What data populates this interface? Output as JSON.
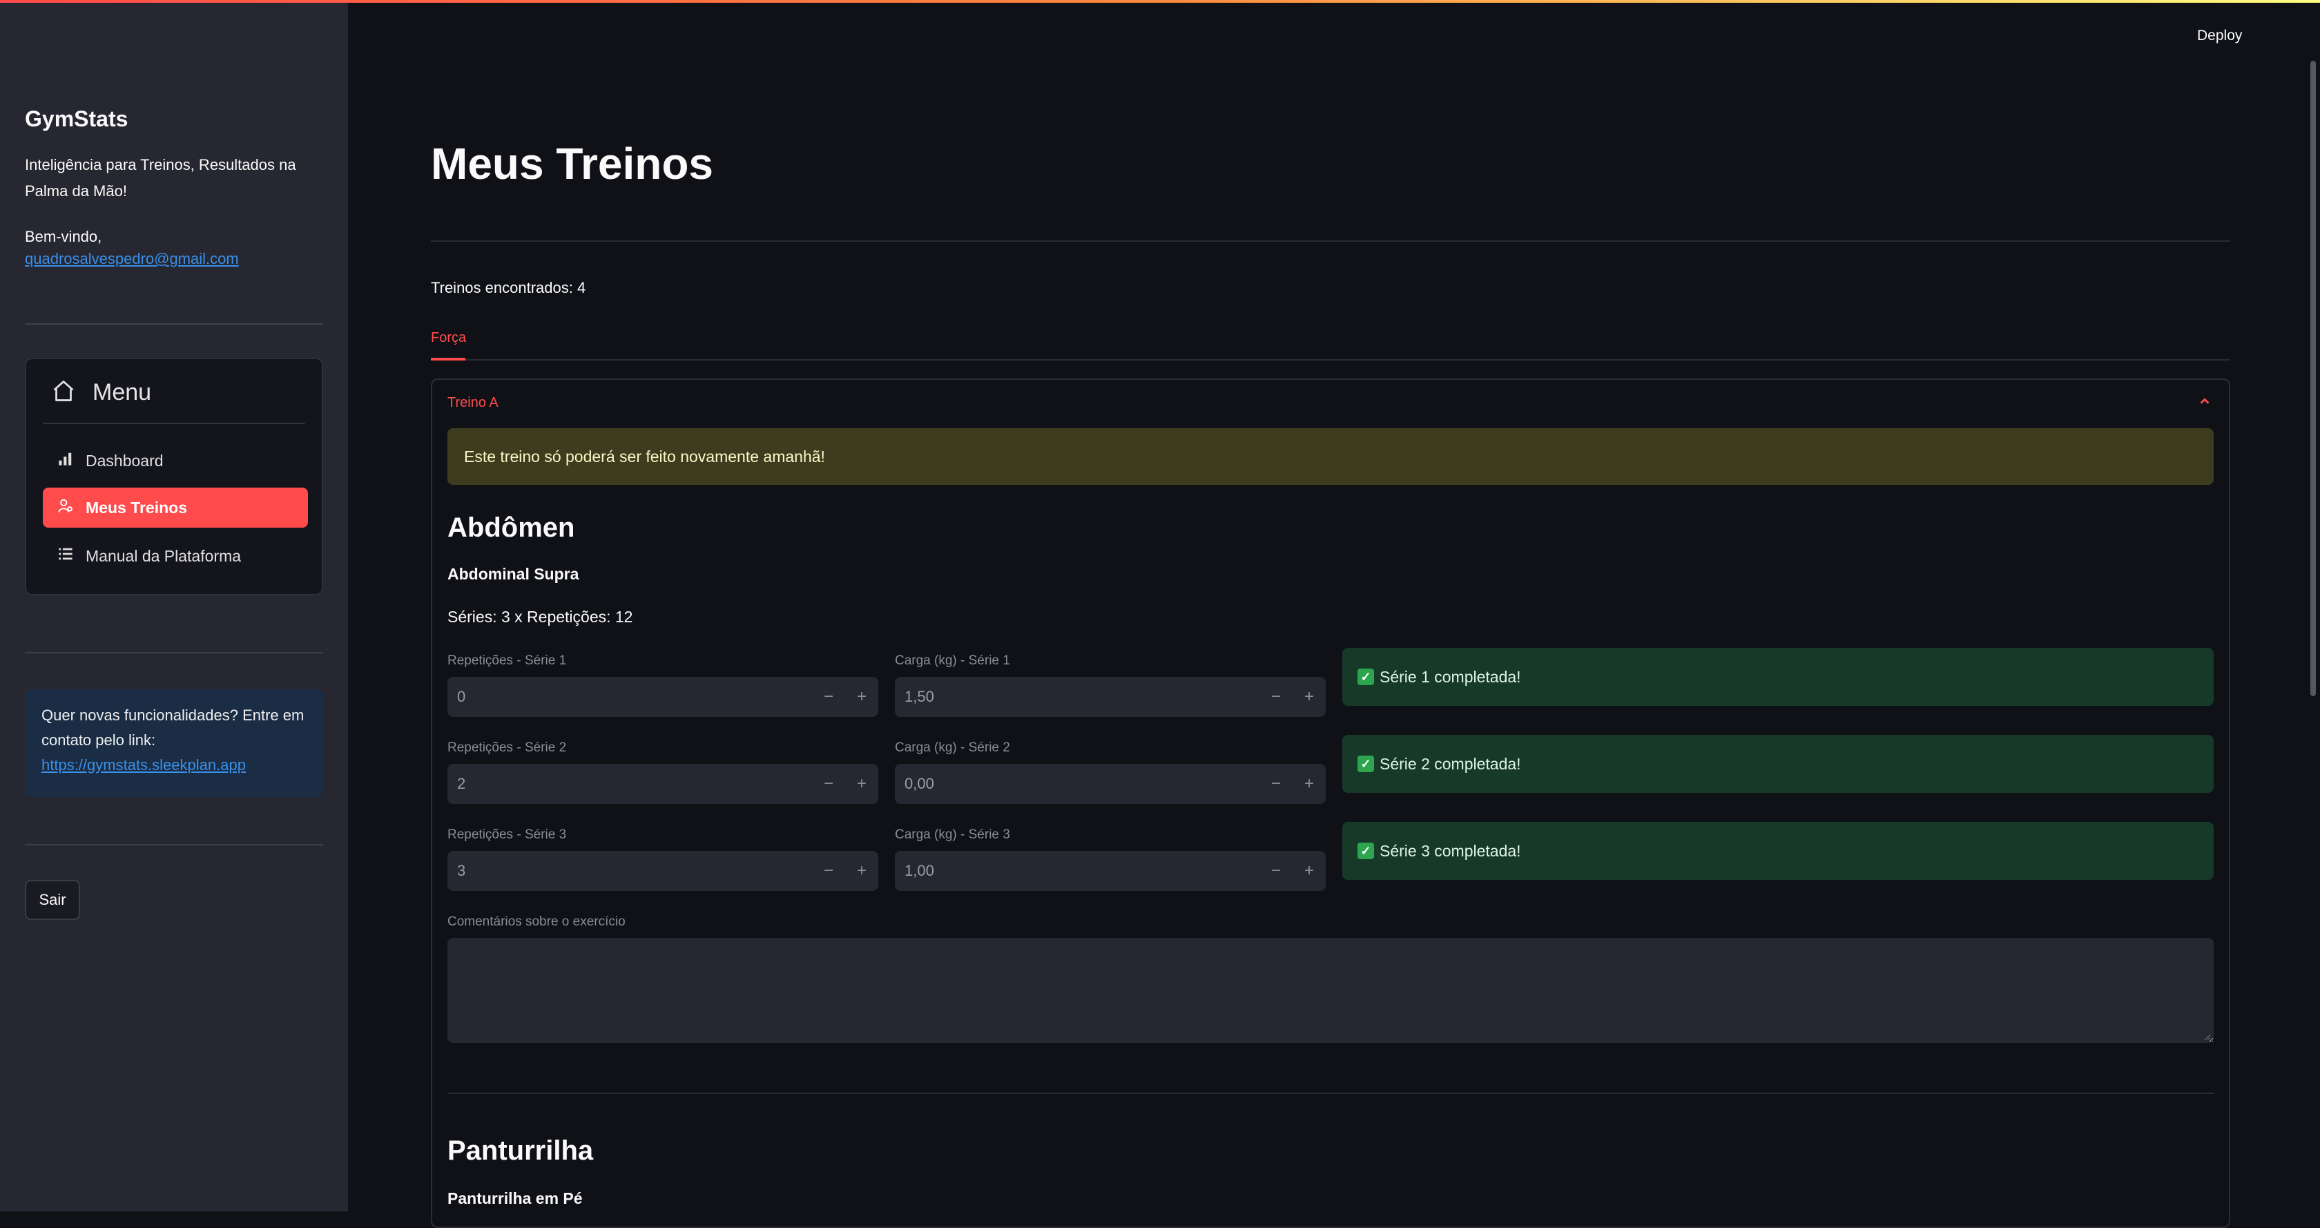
{
  "sidebar": {
    "app_title": "GymStats",
    "tagline": "Inteligência para Treinos, Resultados na Palma da Mão!",
    "welcome": "Bem-vindo,",
    "email": "quadrosalvespedro@gmail.com",
    "menu": {
      "title": "Menu",
      "items": [
        {
          "label": "Dashboard",
          "icon": "bar-chart-icon"
        },
        {
          "label": "Meus Treinos",
          "icon": "person-icon",
          "active": true
        },
        {
          "label": "Manual da Plataforma",
          "icon": "list-icon"
        }
      ]
    },
    "info": {
      "text": "Quer novas funcionalidades? Entre em contato pelo link:",
      "link": "https://gymstats.sleekplan.app"
    },
    "logout_label": "Sair"
  },
  "header": {
    "deploy_label": "Deploy"
  },
  "main": {
    "title": "Meus Treinos",
    "found_text": "Treinos encontrados: 4",
    "tabs": [
      {
        "label": "Força",
        "active": true
      }
    ],
    "expander": {
      "title": "Treino A",
      "warning": "Este treino só poderá ser feito novamente amanhã!",
      "sections": [
        {
          "heading": "Abdômen",
          "exercise": "Abdominal Supra",
          "series_text": "Séries: 3 x Repetições: 12",
          "rows": [
            {
              "reps_label": "Repetições - Série 1",
              "reps_value": "0",
              "load_label": "Carga (kg) - Série 1",
              "load_value": "1,50",
              "status": "Série 1 completada!"
            },
            {
              "reps_label": "Repetições - Série 2",
              "reps_value": "2",
              "load_label": "Carga (kg) - Série 2",
              "load_value": "0,00",
              "status": "Série 2 completada!"
            },
            {
              "reps_label": "Repetições - Série 3",
              "reps_value": "3",
              "load_label": "Carga (kg) - Série 3",
              "load_value": "1,00",
              "status": "Série 3 completada!"
            }
          ],
          "comment_label": "Comentários sobre o exercício",
          "comment_value": ""
        },
        {
          "heading": "Panturrilha",
          "exercise": "Panturrilha em Pé"
        }
      ]
    }
  },
  "colors": {
    "accent": "#ff4b4b",
    "background": "#0f1117",
    "sidebar": "#262730",
    "warning_bg": "#3d3c1f",
    "success_bg": "#173928",
    "info_bg": "#1b2d45",
    "link": "#3a8fe8"
  },
  "stepper": {
    "minus": "−",
    "plus": "+"
  },
  "check_glyph": "✓"
}
